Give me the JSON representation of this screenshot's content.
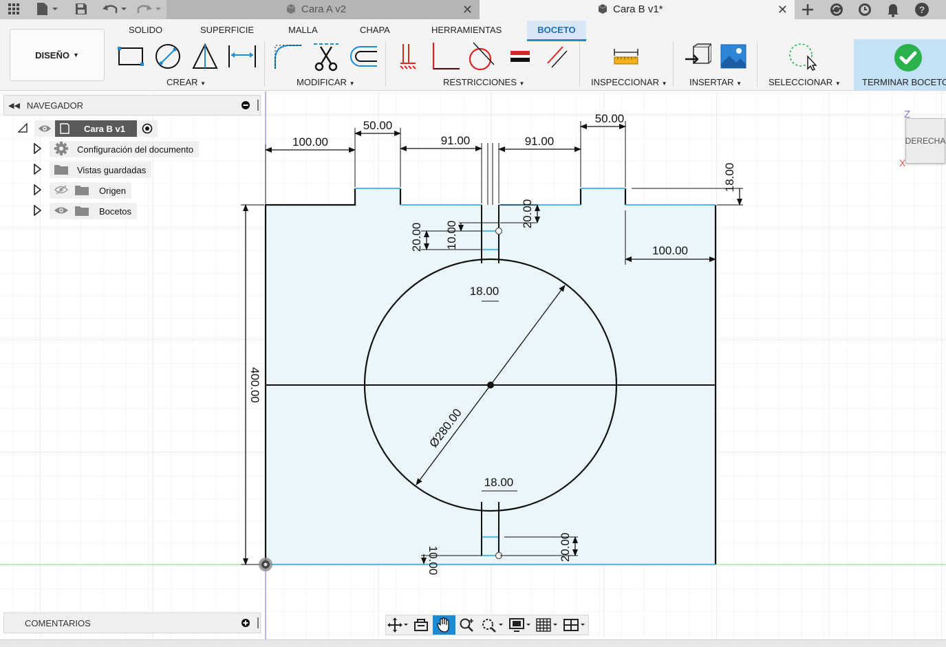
{
  "tabs": [
    {
      "title": "Cara A v2",
      "active": false
    },
    {
      "title": "Cara B v1*",
      "active": true
    }
  ],
  "ribbon": {
    "tabs": [
      "SOLIDO",
      "SUPERFICIE",
      "MALLA",
      "CHAPA",
      "HERRAMIENTAS",
      "BOCETO"
    ],
    "active_tab": "BOCETO",
    "workspace": "DISEÑO",
    "groups": [
      "CREAR",
      "MODIFICAR",
      "RESTRICCIONES",
      "INSPECCIONAR",
      "INSERTAR",
      "SELECCIONAR",
      "TERMINAR BOCETO"
    ]
  },
  "navigator": {
    "title": "NAVEGADOR",
    "root": "Cara B v1",
    "items": [
      {
        "label": "Configuración del documento",
        "icon": "gear-icon"
      },
      {
        "label": "Vistas guardadas",
        "icon": "folder-icon"
      },
      {
        "label": "Origen",
        "icon": "folder-icon"
      },
      {
        "label": "Bocetos",
        "icon": "folder-icon"
      }
    ]
  },
  "comments": {
    "title": "COMENTARIOS"
  },
  "viewcube": {
    "face": "DERECHA",
    "axis_z": "Z",
    "axis_x": "X"
  },
  "dimensions": {
    "d_100_top_left": "100.00",
    "d_50_left": "50.00",
    "d_91_left": "91.00",
    "d_91_right": "91.00",
    "d_50_right": "50.00",
    "d_18_vert_right": "18.00",
    "d_100_right": "100.00",
    "d_20_top_a": "20.00",
    "d_10_top": "10.00",
    "d_20_top_b": "20.00",
    "d_18_top_slot": "18.00",
    "d_400": "400.00",
    "d_280": "Ø280.00",
    "d_18_bottom_slot": "18.00",
    "d_10_bottom": "10.00",
    "d_20_bottom": "20.00"
  },
  "colors": {
    "accent": "#1d8ad4",
    "sketch_fill": "#eaf6fa",
    "profile_line": "#5bb8df",
    "finish_green": "#2bb24c"
  }
}
